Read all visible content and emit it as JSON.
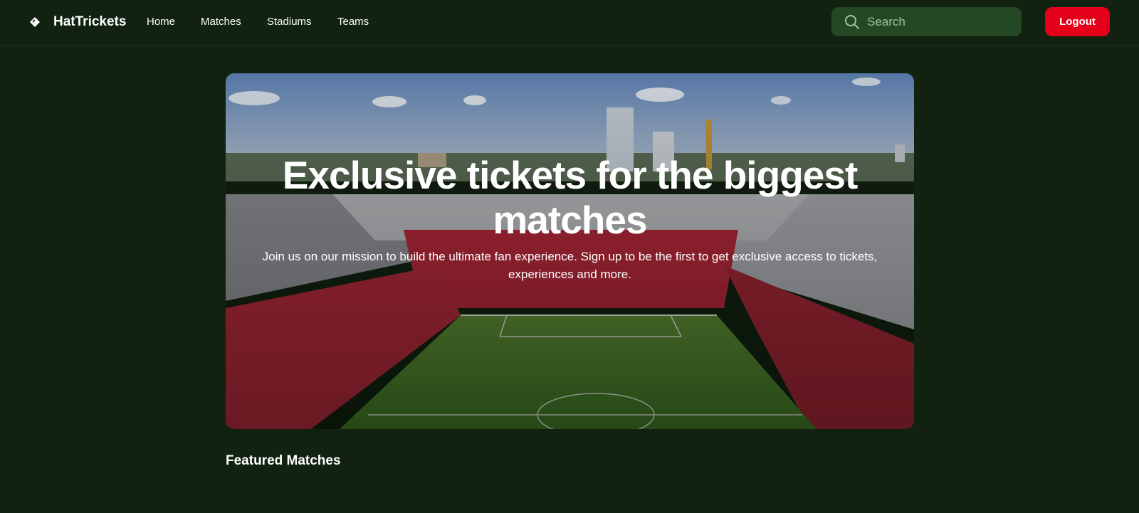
{
  "header": {
    "brand": "HatTrickets",
    "nav": [
      {
        "label": "Home"
      },
      {
        "label": "Matches"
      },
      {
        "label": "Stadiums"
      },
      {
        "label": "Teams"
      }
    ],
    "search": {
      "placeholder": "Search",
      "value": ""
    },
    "logout_label": "Logout"
  },
  "hero": {
    "title": "Exclusive tickets for the biggest matches",
    "subtitle": "Join us on our mission to build the ultimate fan experience. Sign up to be the first to get exclusive access to tickets, experiences and more."
  },
  "sections": {
    "featured_title": "Featured Matches"
  },
  "colors": {
    "background": "#112211",
    "search_bg": "#244724",
    "accent": "#e5001a"
  },
  "icons": {
    "logo": "ticket-diamond-icon",
    "search": "search-icon"
  }
}
